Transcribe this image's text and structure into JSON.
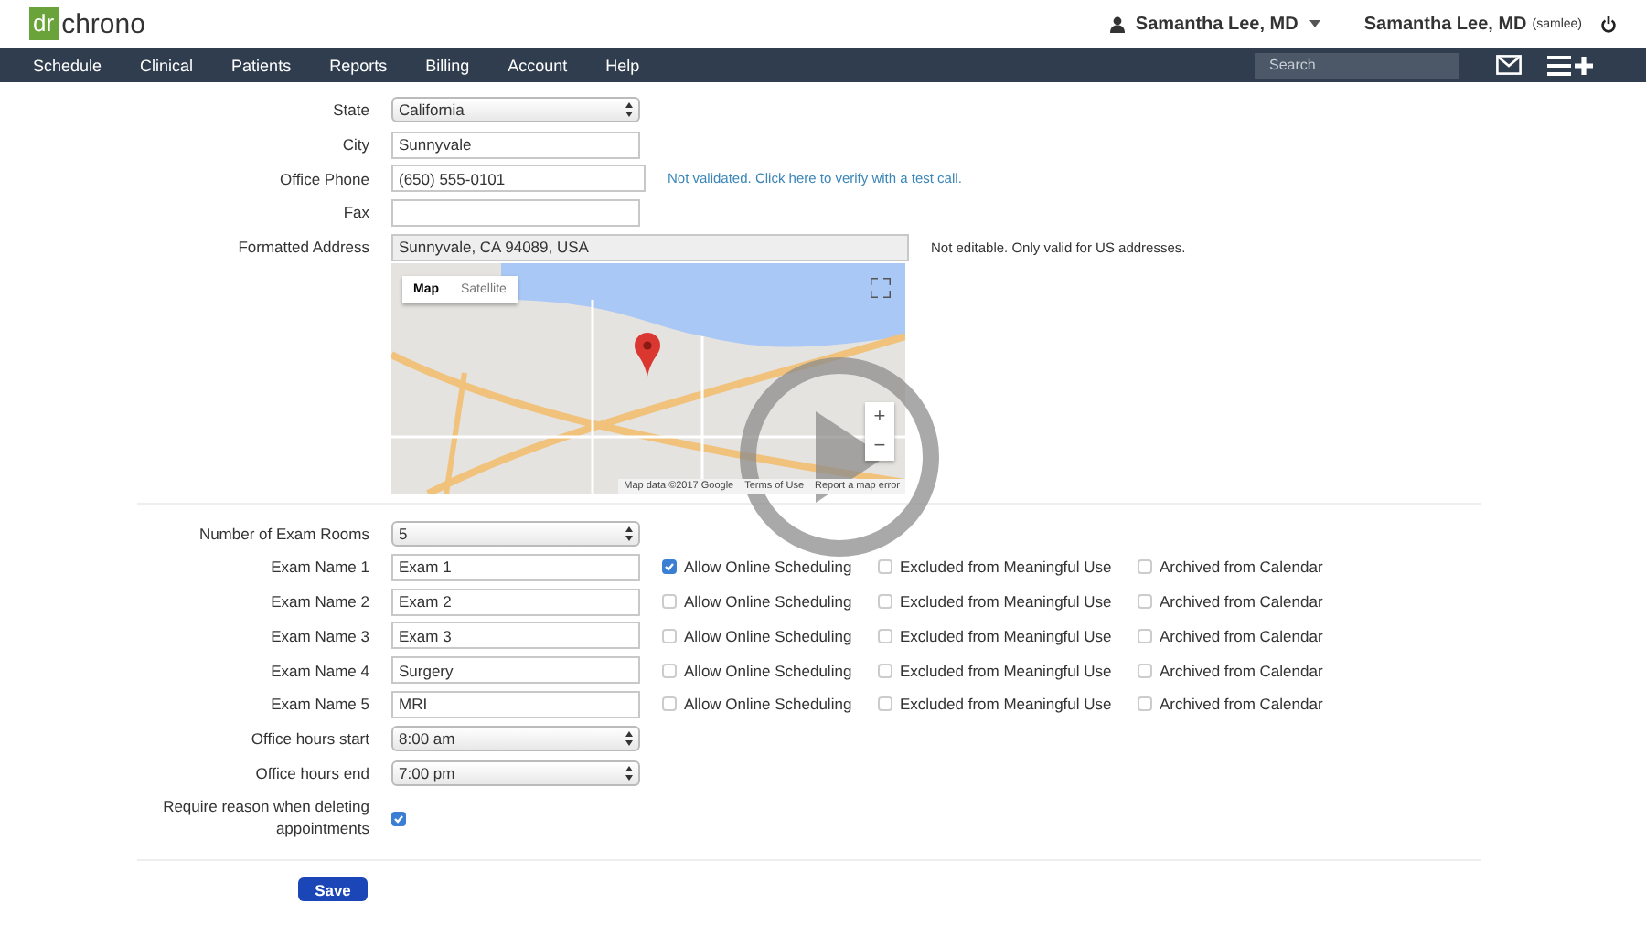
{
  "header": {
    "logo_mark": "dr",
    "logo_text": "chrono",
    "user_menu": "Samantha Lee, MD",
    "account_name": "Samantha Lee, MD",
    "account_handle": "(samlee)"
  },
  "nav": {
    "items": [
      "Schedule",
      "Clinical",
      "Patients",
      "Reports",
      "Billing",
      "Account",
      "Help"
    ],
    "search_placeholder": "Search"
  },
  "address_fields": [
    {
      "label": "State",
      "kind": "select",
      "value": "California"
    },
    {
      "label": "City",
      "kind": "text",
      "value": "Sunnyvale"
    },
    {
      "label": "Office Phone",
      "kind": "text",
      "value": "(650) 555-0101",
      "link": "Not validated. Click here to verify with a test call."
    },
    {
      "label": "Fax",
      "kind": "text"
    },
    {
      "label": "Formatted Address",
      "kind": "readonly",
      "value": "Sunnyvale, CA 94089, USA",
      "note": "Not editable. Only valid for US addresses."
    }
  ],
  "map": {
    "map_types": [
      {
        "label": "Map",
        "selected": true
      },
      {
        "label": "Satellite",
        "selected": false
      }
    ],
    "zoom_in": "+",
    "zoom_out": "−",
    "attribution": "Map data ©2017 Google",
    "links": [
      "Terms of Use",
      "Report a map error"
    ]
  },
  "exam_rooms": {
    "label": "Number of Exam Rooms",
    "value": "5"
  },
  "exams": [
    {
      "label": "Exam Name 1",
      "value": "Exam 1",
      "options": [
        {
          "label": "Allow Online Scheduling",
          "checked": true
        },
        {
          "label": "Excluded from Meaningful Use",
          "checked": false
        },
        {
          "label": "Archived from Calendar",
          "checked": false
        }
      ]
    },
    {
      "label": "Exam Name 2",
      "value": "Exam 2",
      "options": [
        {
          "label": "Allow Online Scheduling",
          "checked": false
        },
        {
          "label": "Excluded from Meaningful Use",
          "checked": false
        },
        {
          "label": "Archived from Calendar",
          "checked": false
        }
      ]
    },
    {
      "label": "Exam Name 3",
      "value": "Exam 3",
      "options": [
        {
          "label": "Allow Online Scheduling",
          "checked": false
        },
        {
          "label": "Excluded from Meaningful Use",
          "checked": false
        },
        {
          "label": "Archived from Calendar",
          "checked": false
        }
      ]
    },
    {
      "label": "Exam Name 4",
      "value": "Surgery",
      "options": [
        {
          "label": "Allow Online Scheduling",
          "checked": false
        },
        {
          "label": "Excluded from Meaningful Use",
          "checked": false
        },
        {
          "label": "Archived from Calendar",
          "checked": false
        }
      ]
    },
    {
      "label": "Exam Name 5",
      "value": "MRI",
      "options": [
        {
          "label": "Allow Online Scheduling",
          "checked": false
        },
        {
          "label": "Excluded from Meaningful Use",
          "checked": false
        },
        {
          "label": "Archived from Calendar",
          "checked": false
        }
      ]
    }
  ],
  "hours": [
    {
      "label": "Office hours start",
      "value": "8:00 am"
    },
    {
      "label": "Office hours end",
      "value": "7:00 pm"
    }
  ],
  "require_reason": {
    "label": "Require reason when deleting appointments",
    "checked": true
  },
  "save": "Save"
}
